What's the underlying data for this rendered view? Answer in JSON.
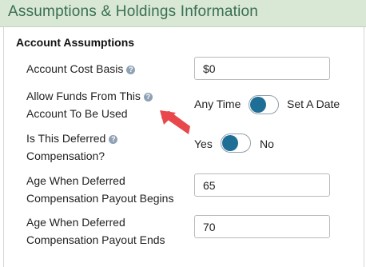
{
  "header": {
    "title": "Assumptions & Holdings Information"
  },
  "section": {
    "title": "Account Assumptions"
  },
  "fields": {
    "cost_basis": {
      "label": "Account Cost Basis",
      "value": "$0"
    },
    "allow_funds": {
      "label_line1": "Allow Funds From This",
      "label_line2": "Account To Be Used",
      "option_left": "Any Time",
      "option_right": "Set A Date",
      "selected": "Any Time"
    },
    "deferred": {
      "label_line1": "Is This Deferred",
      "label_line2": "Compensation?",
      "option_left": "Yes",
      "option_right": "No",
      "selected": "Yes"
    },
    "payout_begins": {
      "label_line1": "Age When Deferred",
      "label_line2": "Compensation Payout Begins",
      "value": "65"
    },
    "payout_ends": {
      "label_line1": "Age When Deferred",
      "label_line2": "Compensation Payout Ends",
      "value": "70"
    }
  },
  "help_icon": "?",
  "colors": {
    "header_bg": "#d8e8d4",
    "header_text": "#3a6e55",
    "toggle_knob": "#1f6e96",
    "help_icon": "#8fa1b5",
    "arrow": "#e8474c"
  }
}
